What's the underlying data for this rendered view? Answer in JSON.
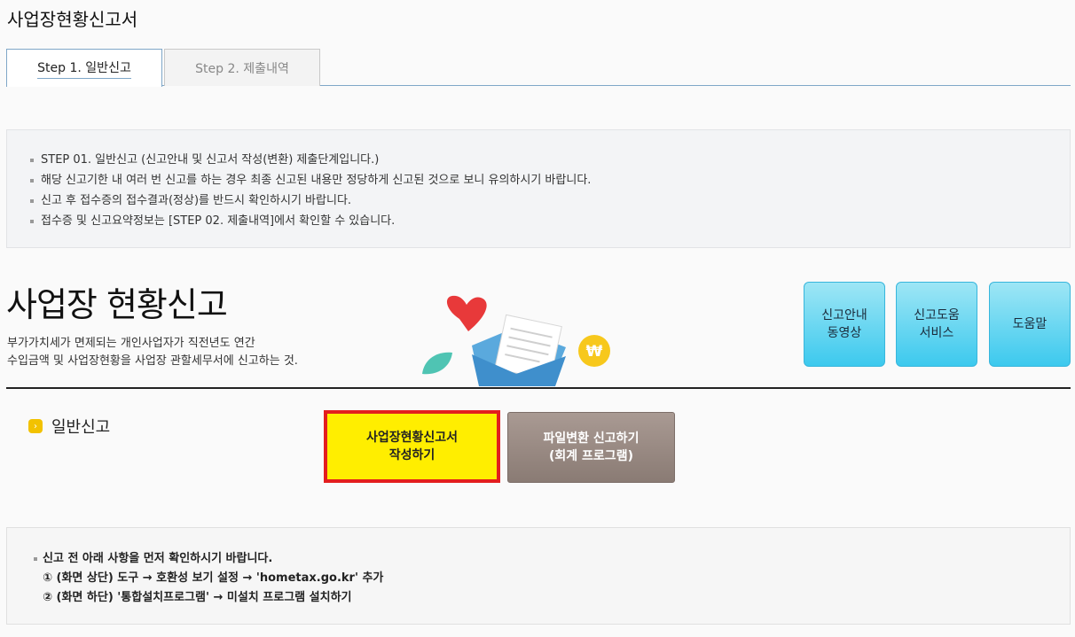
{
  "page": {
    "title": "사업장현황신고서"
  },
  "tabs": [
    {
      "label": "Step 1. 일반신고"
    },
    {
      "label": "Step 2. 제출내역"
    }
  ],
  "notice": {
    "items": [
      "STEP 01. 일반신고 (신고안내 및 신고서 작성(변환) 제출단계입니다.)",
      "해당 신고기한 내 여러 번 신고를 하는 경우 최종 신고된 내용만 정당하게 신고된 것으로 보니 유의하시기 바랍니다.",
      "신고 후 접수증의 접수결과(정상)를 반드시 확인하시기 바랍니다.",
      "접수증 및 신고요약정보는 [STEP 02. 제출내역]에서 확인할 수 있습니다."
    ]
  },
  "section": {
    "title": "사업장 현황신고",
    "desc_line1": "부가가치세가 면제되는 개인사업자가 직전년도 연간",
    "desc_line2": "수입금액 및 사업장현황을 사업장 관할세무서에 신고하는 것."
  },
  "help_buttons": {
    "video": "신고안내\n동영상",
    "service": "신고도움\n서비스",
    "help": "도움말"
  },
  "general": {
    "label": "일반신고",
    "write_button": "사업장현황신고서\n작성하기",
    "file_button": "파일변환 신고하기\n(회계 프로그램)"
  },
  "check": {
    "line1": "신고 전 아래 사항을 먼저 확인하시기 바랍니다.",
    "line2": "① (화면 상단) 도구 → 호환성 보기 설정 → 'hometax.go.kr' 추가",
    "line3": "② (화면 하단) '통합설치프로그램' → 미설치 프로그램 설치하기"
  },
  "colors": {
    "accent_border": "#7fa7c8",
    "help_button": "#3cc9ee",
    "write_button": "#ffee00",
    "write_button_border": "#e31e1e",
    "file_button": "#8a7b74"
  }
}
